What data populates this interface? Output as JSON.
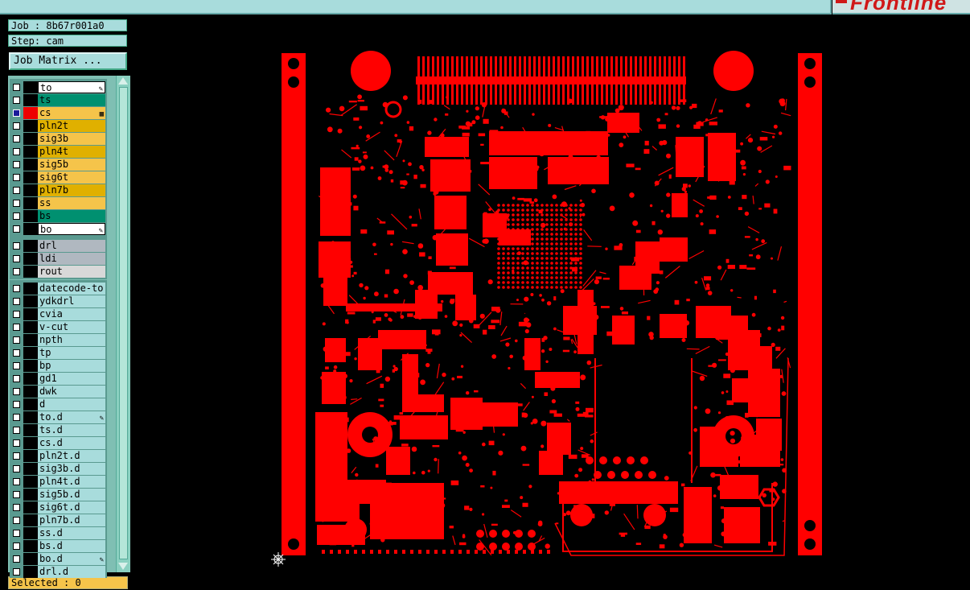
{
  "app": {
    "logo": "Frontline"
  },
  "job": {
    "job_line": "Job : 8b67r001a0",
    "step_line": "Step: cam"
  },
  "buttons": {
    "job_matrix": "Job Matrix ..."
  },
  "colors": {
    "pcb_copper": "#ff0000",
    "canvas_bg": "#000000",
    "panel": "#a8dcdc",
    "signal_layer": "#e0b000",
    "mask_layer": "#009070",
    "drill_layer": "#b0b8c0",
    "layer_selected": "#f5c44a"
  },
  "layers": {
    "board": [
      {
        "name": "to",
        "bg": "#ffffff",
        "flag": "✎",
        "selected": false,
        "border": true
      },
      {
        "name": "ts",
        "bg": "#009070",
        "flag": "",
        "selected": false,
        "border": false
      },
      {
        "name": "cs",
        "bg": "#f5c44a",
        "flag": "▦",
        "selected": true,
        "border": false
      },
      {
        "name": "pln2t",
        "bg": "#e0b000",
        "flag": "",
        "selected": false,
        "border": false
      },
      {
        "name": "sig3b",
        "bg": "#f5c44a",
        "flag": "",
        "selected": false,
        "border": false
      },
      {
        "name": "pln4t",
        "bg": "#e0b000",
        "flag": "",
        "selected": false,
        "border": false
      },
      {
        "name": "sig5b",
        "bg": "#f5c44a",
        "flag": "",
        "selected": false,
        "border": false
      },
      {
        "name": "sig6t",
        "bg": "#f5c44a",
        "flag": "",
        "selected": false,
        "border": false
      },
      {
        "name": "pln7b",
        "bg": "#e0b000",
        "flag": "",
        "selected": false,
        "border": false
      },
      {
        "name": "ss",
        "bg": "#f5c44a",
        "flag": "",
        "selected": false,
        "border": false
      },
      {
        "name": "bs",
        "bg": "#009070",
        "flag": "",
        "selected": false,
        "border": false
      },
      {
        "name": "bo",
        "bg": "#ffffff",
        "flag": "✎",
        "selected": false,
        "border": true
      }
    ],
    "drill": [
      {
        "name": "drl",
        "bg": "#b0b8c0"
      },
      {
        "name": "ldi",
        "bg": "#b0b8c0"
      },
      {
        "name": "rout",
        "bg": "#d8d8d8"
      }
    ],
    "misc": [
      {
        "name": "datecode-to",
        "flag": ""
      },
      {
        "name": "ydkdrl",
        "flag": ""
      },
      {
        "name": "cvia",
        "flag": ""
      },
      {
        "name": "v-cut",
        "flag": ""
      },
      {
        "name": "npth",
        "flag": ""
      },
      {
        "name": "tp",
        "flag": ""
      },
      {
        "name": "bp",
        "flag": ""
      },
      {
        "name": "gd1",
        "flag": ""
      },
      {
        "name": "dwk",
        "flag": ""
      },
      {
        "name": "d",
        "flag": ""
      },
      {
        "name": "to.d",
        "flag": "✎"
      },
      {
        "name": "ts.d",
        "flag": ""
      },
      {
        "name": "cs.d",
        "flag": ""
      },
      {
        "name": "pln2t.d",
        "flag": ""
      },
      {
        "name": "sig3b.d",
        "flag": ""
      },
      {
        "name": "pln4t.d",
        "flag": ""
      },
      {
        "name": "sig5b.d",
        "flag": ""
      },
      {
        "name": "sig6t.d",
        "flag": ""
      },
      {
        "name": "pln7b.d",
        "flag": ""
      },
      {
        "name": "ss.d",
        "flag": ""
      },
      {
        "name": "bs.d",
        "flag": ""
      },
      {
        "name": "bo.d",
        "flag": "✎"
      },
      {
        "name": "drl.d",
        "flag": ""
      }
    ]
  },
  "status": {
    "selected": "Selected : 0"
  },
  "icons": {
    "cursor": "crosshair-cursor-icon",
    "edit": "pencil-icon"
  }
}
